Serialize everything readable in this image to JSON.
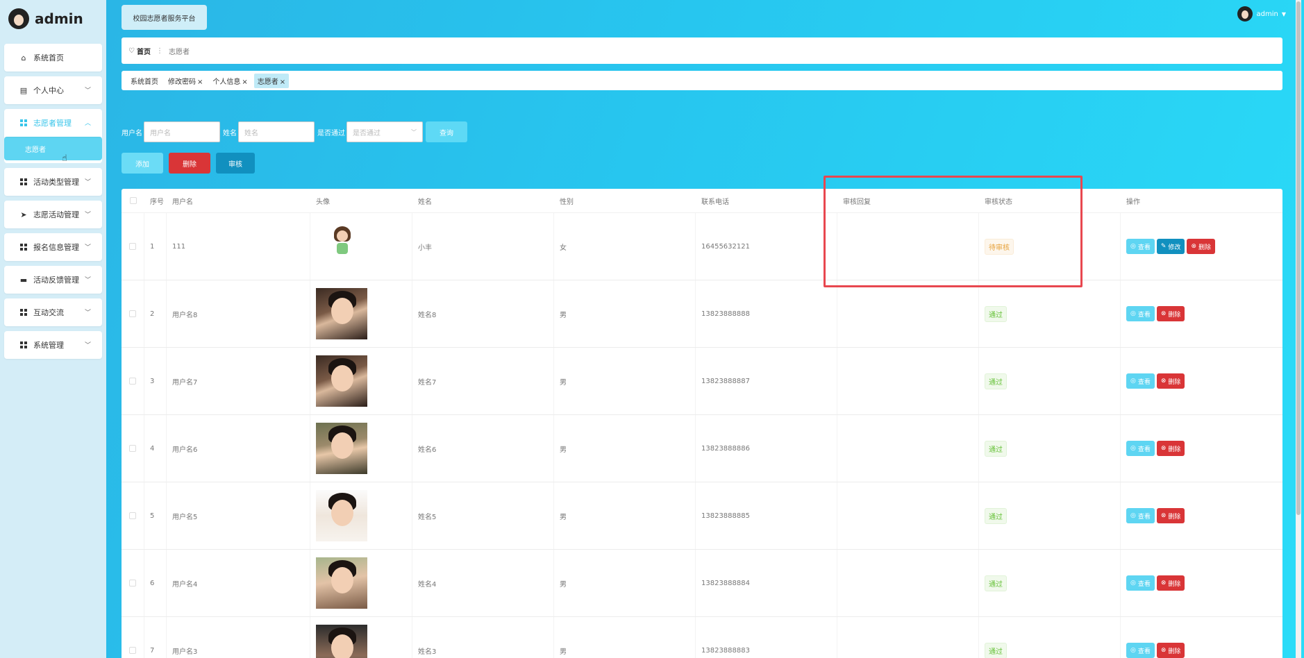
{
  "app": {
    "logo_name": "admin",
    "brand": "校园志愿者服务平台",
    "user": "admin"
  },
  "sidebar": {
    "items": [
      {
        "label": "系统首页"
      },
      {
        "label": "个人中心"
      },
      {
        "label": "志愿者管理",
        "sub": "志愿者"
      },
      {
        "label": "活动类型管理"
      },
      {
        "label": "志愿活动管理"
      },
      {
        "label": "报名信息管理"
      },
      {
        "label": "活动反馈管理"
      },
      {
        "label": "互动交流"
      },
      {
        "label": "系统管理"
      }
    ]
  },
  "breadcrumb": {
    "home": "首页",
    "current": "志愿者"
  },
  "tags": [
    {
      "label": "系统首页",
      "closable": false
    },
    {
      "label": "修改密码",
      "closable": true
    },
    {
      "label": "个人信息",
      "closable": true
    },
    {
      "label": "志愿者",
      "closable": true
    }
  ],
  "search": {
    "username_label": "用户名",
    "username_placeholder": "用户名",
    "name_label": "姓名",
    "name_placeholder": "姓名",
    "pass_label": "是否通过",
    "pass_placeholder": "是否通过",
    "query": "查询"
  },
  "actions": {
    "add": "添加",
    "delete": "删除",
    "audit": "审核"
  },
  "table": {
    "headers": [
      "序号",
      "用户名",
      "头像",
      "姓名",
      "性别",
      "联系电话",
      "审核回复",
      "审核状态",
      "操作"
    ],
    "rows": [
      {
        "no": "1",
        "user": "111",
        "name": "小丰",
        "sex": "女",
        "tel": "16455632121",
        "reply": "",
        "state": "待审核",
        "ops": [
          "查看",
          "修改",
          "删除"
        ]
      },
      {
        "no": "2",
        "user": "用户名8",
        "name": "姓名8",
        "sex": "男",
        "tel": "13823888888",
        "reply": "",
        "state": "通过",
        "ops": [
          "查看",
          "删除"
        ]
      },
      {
        "no": "3",
        "user": "用户名7",
        "name": "姓名7",
        "sex": "男",
        "tel": "13823888887",
        "reply": "",
        "state": "通过",
        "ops": [
          "查看",
          "删除"
        ]
      },
      {
        "no": "4",
        "user": "用户名6",
        "name": "姓名6",
        "sex": "男",
        "tel": "13823888886",
        "reply": "",
        "state": "通过",
        "ops": [
          "查看",
          "删除"
        ]
      },
      {
        "no": "5",
        "user": "用户名5",
        "name": "姓名5",
        "sex": "男",
        "tel": "13823888885",
        "reply": "",
        "state": "通过",
        "ops": [
          "查看",
          "删除"
        ]
      },
      {
        "no": "6",
        "user": "用户名4",
        "name": "姓名4",
        "sex": "男",
        "tel": "13823888884",
        "reply": "",
        "state": "通过",
        "ops": [
          "查看",
          "删除"
        ]
      },
      {
        "no": "7",
        "user": "用户名3",
        "name": "姓名3",
        "sex": "男",
        "tel": "13823888883",
        "reply": "",
        "state": "通过",
        "ops": [
          "查看",
          "删除"
        ]
      }
    ]
  },
  "colors": {
    "accent": "#38c5ea",
    "danger": "#d93537",
    "primary": "#1190bf",
    "highlight": "#e8474f"
  }
}
